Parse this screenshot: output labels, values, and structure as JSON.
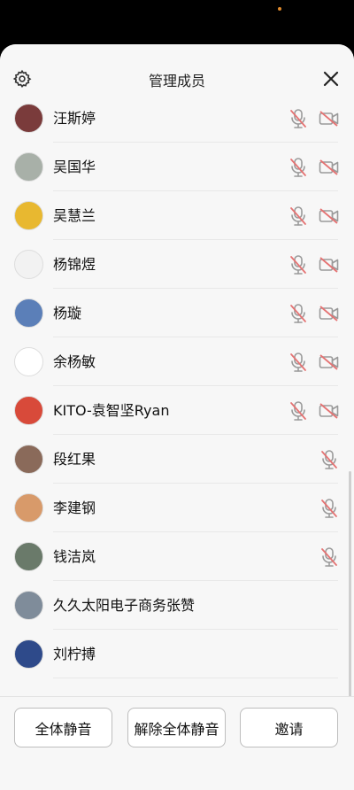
{
  "header": {
    "title": "管理成员"
  },
  "colors": {
    "muted_icon": "#e57373",
    "icon_gray": "#9a9a9a",
    "sheet_bg": "#f7f7f7"
  },
  "members": [
    {
      "name": "汪斯婷",
      "mic_muted": true,
      "camera_off": true,
      "avatar_color": "#7a3b3b"
    },
    {
      "name": "吴国华",
      "mic_muted": true,
      "camera_off": true,
      "avatar_color": "#a8b0a8"
    },
    {
      "name": "吴慧兰",
      "mic_muted": true,
      "camera_off": true,
      "avatar_color": "#e8b830"
    },
    {
      "name": "杨锦煜",
      "mic_muted": true,
      "camera_off": true,
      "avatar_color": "#f2f2f2"
    },
    {
      "name": "杨璇",
      "mic_muted": true,
      "camera_off": true,
      "avatar_color": "#5b7fb8"
    },
    {
      "name": "余杨敏",
      "mic_muted": true,
      "camera_off": true,
      "avatar_color": "#ffffff"
    },
    {
      "name": "KITO-袁智坚Ryan",
      "mic_muted": true,
      "camera_off": true,
      "avatar_color": "#d84a3a"
    },
    {
      "name": "段红果",
      "mic_muted": true,
      "camera_off": false,
      "avatar_color": "#8a6a5a"
    },
    {
      "name": "李建钢",
      "mic_muted": true,
      "camera_off": false,
      "avatar_color": "#d89a6a"
    },
    {
      "name": "钱洁岚",
      "mic_muted": true,
      "camera_off": false,
      "avatar_color": "#6a7a6a"
    },
    {
      "name": "久久太阳电子商务张赞",
      "mic_muted": false,
      "camera_off": false,
      "avatar_color": "#7f8c9a"
    },
    {
      "name": "刘柠搏",
      "mic_muted": false,
      "camera_off": false,
      "avatar_color": "#2e4a8a"
    }
  ],
  "footer": {
    "mute_all_label": "全体静音",
    "unmute_all_label": "解除全体静音",
    "invite_label": "邀请"
  }
}
